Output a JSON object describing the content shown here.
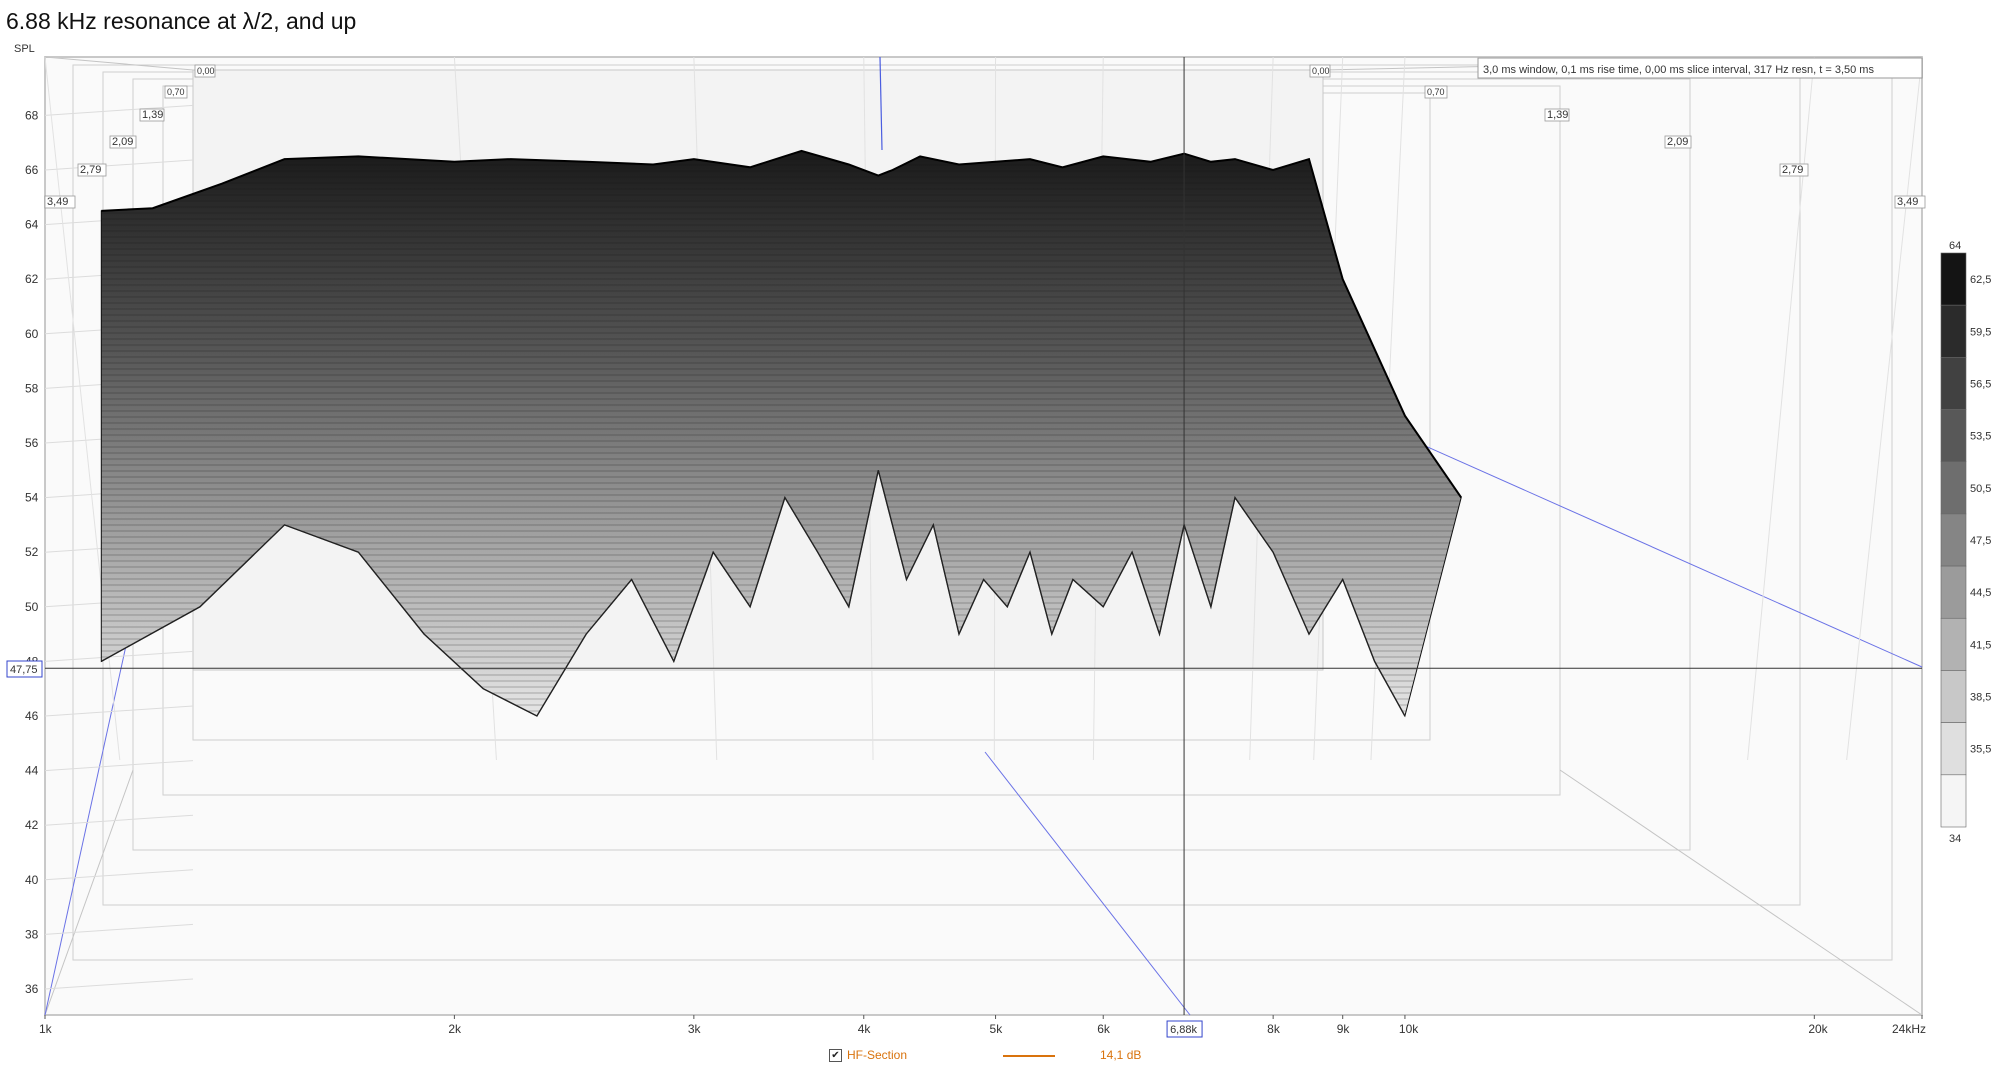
{
  "title": "6.88 kHz resonance at λ/2, and up",
  "info_text": "3,0 ms window, 0,1 ms rise time, 0,00 ms slice interval, 317 Hz resn, t = 3,50 ms",
  "legend": {
    "checked": true,
    "check_glyph": "✔",
    "label": "HF-Section",
    "value": "14,1 dB",
    "color": "#d9730d"
  },
  "cursor": {
    "freq_label": "6,88k",
    "spl_label": "47,75",
    "freq_value": 6880,
    "spl_value": 47.75
  },
  "chart_data": {
    "type": "waterfall",
    "title": "6.88 kHz resonance at λ/2, and up",
    "ylabel": "SPL",
    "xunit": "kHz",
    "xscale": "log",
    "xlim": [
      1000,
      24000
    ],
    "ylim": [
      35,
      69
    ],
    "x_ticks": [
      {
        "v": 1000,
        "label": "1k"
      },
      {
        "v": 2000,
        "label": "2k"
      },
      {
        "v": 3000,
        "label": "3k"
      },
      {
        "v": 4000,
        "label": "4k"
      },
      {
        "v": 5000,
        "label": "5k"
      },
      {
        "v": 6000,
        "label": "6k"
      },
      {
        "v": 8000,
        "label": "8k"
      },
      {
        "v": 9000,
        "label": "9k"
      },
      {
        "v": 10000,
        "label": "10k"
      },
      {
        "v": 20000,
        "label": "20k"
      },
      {
        "v": 24000,
        "label": "24kHz"
      }
    ],
    "y_ticks": [
      36,
      38,
      40,
      42,
      44,
      46,
      48,
      50,
      52,
      54,
      56,
      58,
      60,
      62,
      64,
      66,
      68
    ],
    "time_ticks_ms": [
      "0,00",
      "0,70",
      "1,39",
      "2,09",
      "2,79",
      "3,49"
    ],
    "color_scale": {
      "min": 34,
      "max": 64,
      "labels": [
        "64",
        "62,5",
        "59,5",
        "56,5",
        "53,5",
        "50,5",
        "47,5",
        "44,5",
        "41,5",
        "38,5",
        "35,5",
        "34"
      ]
    },
    "front_slice": {
      "x": [
        1100,
        1200,
        1350,
        1500,
        1700,
        2000,
        2200,
        2500,
        2800,
        3000,
        3300,
        3600,
        3900,
        4100,
        4200,
        4400,
        4700,
        5000,
        5300,
        5600,
        6000,
        6500,
        6880,
        7200,
        7500,
        8000,
        8500,
        9000,
        10000,
        11000
      ],
      "y": [
        64.5,
        64.6,
        65.5,
        66.4,
        66.5,
        66.3,
        66.4,
        66.3,
        66.2,
        66.4,
        66.1,
        66.7,
        66.2,
        65.8,
        66.0,
        66.5,
        66.2,
        66.3,
        66.4,
        66.1,
        66.5,
        66.3,
        66.6,
        66.3,
        66.4,
        66.0,
        66.4,
        62.0,
        57.0,
        54.0
      ]
    },
    "decayed_slice": {
      "x": [
        1100,
        1300,
        1500,
        1700,
        1900,
        2100,
        2300,
        2500,
        2700,
        2900,
        3100,
        3300,
        3500,
        3700,
        3900,
        4100,
        4300,
        4500,
        4700,
        4900,
        5100,
        5300,
        5500,
        5700,
        6000,
        6300,
        6600,
        6880,
        7200,
        7500,
        8000,
        8500,
        9000,
        9500,
        10000
      ],
      "y": [
        48,
        50,
        53,
        52,
        49,
        47,
        46,
        49,
        51,
        48,
        52,
        50,
        54,
        52,
        50,
        55,
        51,
        53,
        49,
        51,
        50,
        52,
        49,
        51,
        50,
        52,
        49,
        53,
        50,
        54,
        52,
        49,
        51,
        48,
        46
      ]
    }
  }
}
